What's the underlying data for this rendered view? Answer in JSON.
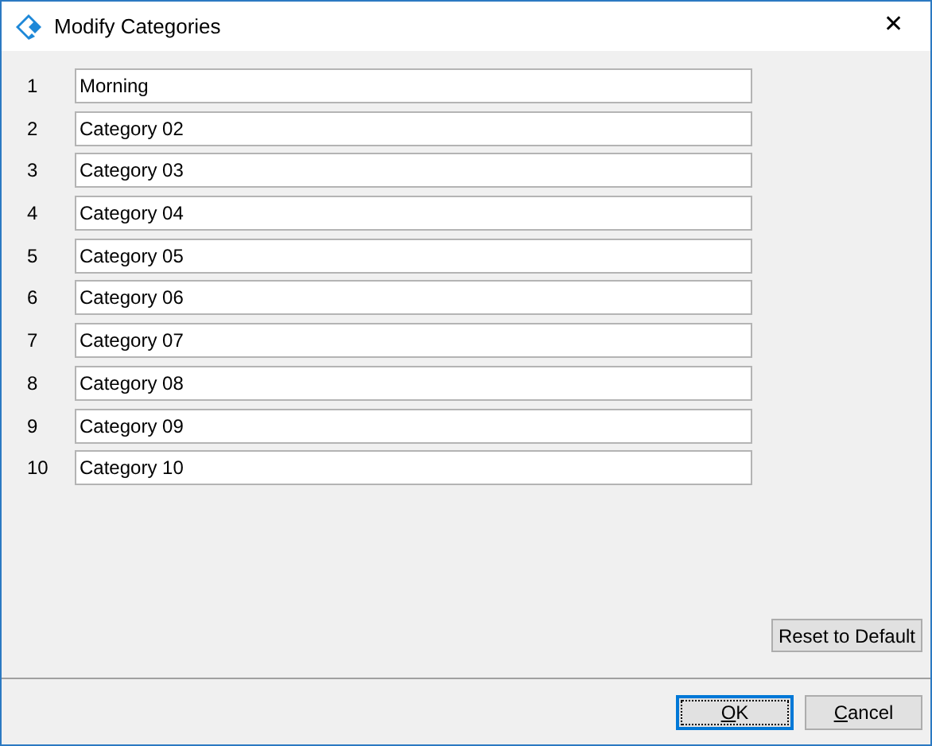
{
  "window": {
    "title": "Modify Categories",
    "close": "✕"
  },
  "categories": [
    {
      "number": "1",
      "value": "Morning"
    },
    {
      "number": "2",
      "value": "Category 02"
    },
    {
      "number": "3",
      "value": "Category 03"
    },
    {
      "number": "4",
      "value": "Category 04"
    },
    {
      "number": "5",
      "value": "Category 05"
    },
    {
      "number": "6",
      "value": "Category 06"
    },
    {
      "number": "7",
      "value": "Category 07"
    },
    {
      "number": "8",
      "value": "Category 08"
    },
    {
      "number": "9",
      "value": "Category 09"
    },
    {
      "number": "10",
      "value": "Category 10"
    }
  ],
  "reset_button": "Reset to Default",
  "buttons": [
    {
      "label": "OK",
      "default": true
    },
    {
      "label": "Cancel",
      "default": false
    }
  ]
}
